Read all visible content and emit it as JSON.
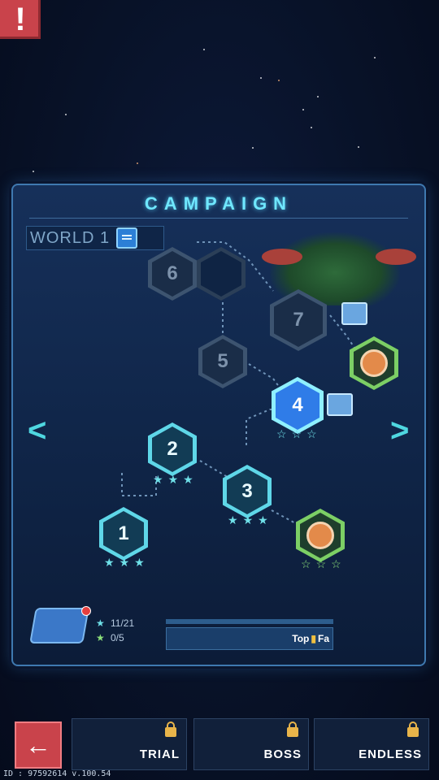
{
  "alert": {
    "label": "!"
  },
  "panel": {
    "title": "CAMPAIGN",
    "world_label": "WORLD 1"
  },
  "levels": [
    {
      "id": "6",
      "label": "6",
      "state": "locked",
      "stars": 0
    },
    {
      "id": "7",
      "label": "7",
      "state": "locked",
      "stars": 0
    },
    {
      "id": "5",
      "label": "5",
      "state": "locked",
      "stars": 0
    },
    {
      "id": "4",
      "label": "4",
      "state": "current",
      "stars": 3
    },
    {
      "id": "2",
      "label": "2",
      "state": "done",
      "stars": 3
    },
    {
      "id": "3",
      "label": "3",
      "state": "done",
      "stars": 3
    },
    {
      "id": "1",
      "label": "1",
      "state": "done",
      "stars": 3
    }
  ],
  "progress": {
    "stars_count": "11/21",
    "boss_count": "0/5",
    "rank_label": "Top",
    "rank_suffix": "Fa"
  },
  "nav": {
    "prev": "<",
    "next": ">"
  },
  "bottom": {
    "back_label": "←",
    "modes": [
      {
        "label": "TRIAL",
        "locked": true
      },
      {
        "label": "BOSS",
        "locked": true
      },
      {
        "label": "ENDLESS",
        "locked": true
      }
    ]
  },
  "footer": {
    "id_text": "ID : 97592614 v.100.54"
  }
}
